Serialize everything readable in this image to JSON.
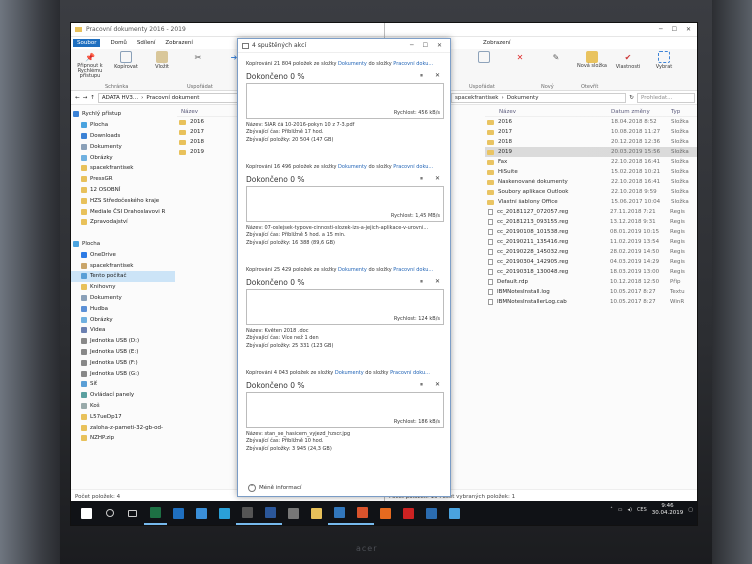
{
  "left_window": {
    "title": "Pracovní dokumenty 2016 - 2019",
    "tabs": [
      "Soubor",
      "Domů",
      "Sdílení",
      "Zobrazení"
    ],
    "ribbon": {
      "pin_label": "Připnout k Rychlému přístupu",
      "copy_label": "Kopírovat",
      "paste_label": "Vložit",
      "group_clipboard": "Schránka",
      "group_organize": "Uspořádat"
    },
    "address": [
      "ADATA HV3...",
      "Pracovní dokument"
    ],
    "nav": [
      {
        "label": "Rychlý přístup",
        "icon": "star-icon",
        "color": "#3b82d6"
      },
      {
        "label": "Plocha",
        "icon": "desktop-icon",
        "color": "#4aa3df"
      },
      {
        "label": "Downloads",
        "icon": "download-icon",
        "color": "#3b82d6"
      },
      {
        "label": "Dokumenty",
        "icon": "documents-icon",
        "color": "#8aa0b8"
      },
      {
        "label": "Obrázky",
        "icon": "pictures-icon",
        "color": "#6fb0e0"
      },
      {
        "label": "spacekfrantisek",
        "icon": "folder-icon",
        "color": "#e8c15a"
      },
      {
        "label": "PressGR",
        "icon": "folder-icon",
        "color": "#e8c15a"
      },
      {
        "label": "12 OSOBNÍ",
        "icon": "folder-icon",
        "color": "#e8c15a"
      },
      {
        "label": "HZS Středočeského kraje",
        "icon": "folder-icon",
        "color": "#e8c15a"
      },
      {
        "label": "Mediale ČSI Drahoslavovi R",
        "icon": "folder-icon",
        "color": "#e8c15a"
      },
      {
        "label": "Zpravodajství",
        "icon": "folder-icon",
        "color": "#e8c15a"
      },
      {
        "label": "",
        "icon": "",
        "color": "#fbfbfb"
      },
      {
        "label": "Plocha",
        "icon": "desktop-icon",
        "color": "#4aa3df"
      },
      {
        "label": "OneDrive",
        "icon": "cloud-icon",
        "color": "#2c7be5"
      },
      {
        "label": "spacekfrantisek",
        "icon": "user-icon",
        "color": "#c9a56a"
      },
      {
        "label": "Tento počítač",
        "icon": "computer-icon",
        "color": "#5a9fd6"
      },
      {
        "label": "Knihovny",
        "icon": "library-icon",
        "color": "#e8c15a"
      },
      {
        "label": "Dokumenty",
        "icon": "documents-icon",
        "color": "#8aa0b8"
      },
      {
        "label": "Hudba",
        "icon": "music-icon",
        "color": "#5a8fd6"
      },
      {
        "label": "Obrázky",
        "icon": "pictures-icon",
        "color": "#6fb0e0"
      },
      {
        "label": "Videa",
        "icon": "video-icon",
        "color": "#6a7fb0"
      },
      {
        "label": "Jednotka USB (D:)",
        "icon": "usb-drive-icon",
        "color": "#888888"
      },
      {
        "label": "Jednotka USB (E:)",
        "icon": "usb-drive-icon",
        "color": "#888888"
      },
      {
        "label": "Jednotka USB (F:)",
        "icon": "usb-drive-icon",
        "color": "#888888"
      },
      {
        "label": "Jednotka USB (G:)",
        "icon": "usb-drive-icon",
        "color": "#888888"
      },
      {
        "label": "Síť",
        "icon": "network-icon",
        "color": "#5a9fd6"
      },
      {
        "label": "Ovládací panely",
        "icon": "control-panel-icon",
        "color": "#5aa0a0"
      },
      {
        "label": "Koš",
        "icon": "recycle-bin-icon",
        "color": "#9aa"
      },
      {
        "label": "L57ueDp17",
        "icon": "folder-icon",
        "color": "#e8c15a"
      },
      {
        "label": "zaloha-z-pameti-32-gb-od-",
        "icon": "folder-icon",
        "color": "#e8c15a"
      },
      {
        "label": "NZHP.zip",
        "icon": "zip-icon",
        "color": "#e8c15a"
      }
    ],
    "list_header": "Název",
    "folders": [
      "2016",
      "2017",
      "2018",
      "2019"
    ],
    "status": "Počet položek: 4"
  },
  "right_window": {
    "tabs": [
      "Zobrazení"
    ],
    "ribbon": {
      "new_folder_label": "Nová složka",
      "properties_label": "Vlastnosti",
      "select_label": "Vybrat",
      "group_new": "Nový",
      "group_open": "Otevřít",
      "group_organize": "Uspořádat"
    },
    "address": [
      "spacekfrantisek",
      "Dokumenty"
    ],
    "search_placeholder": "Prohledat...",
    "columns": [
      "Název",
      "Datum změny",
      "Typ"
    ],
    "files": [
      {
        "name": "2016",
        "date": "18.04.2018 8:52",
        "type": "Složka",
        "kind": "folder"
      },
      {
        "name": "2017",
        "date": "10.08.2018 11:27",
        "type": "Složka",
        "kind": "folder"
      },
      {
        "name": "2018",
        "date": "20.12.2018 12:36",
        "type": "Složka",
        "kind": "folder"
      },
      {
        "name": "2019",
        "date": "20.03.2019 15:56",
        "type": "Složka",
        "kind": "folder",
        "selected": true
      },
      {
        "name": "Fax",
        "date": "22.10.2018 16:41",
        "type": "Složka",
        "kind": "folder"
      },
      {
        "name": "HiSuite",
        "date": "15.02.2018 10:21",
        "type": "Složka",
        "kind": "folder"
      },
      {
        "name": "Naskenované dokumenty",
        "date": "22.10.2018 16:41",
        "type": "Složka",
        "kind": "folder"
      },
      {
        "name": "Soubory aplikace Outlook",
        "date": "22.10.2018 9:59",
        "type": "Složka",
        "kind": "folder"
      },
      {
        "name": "Vlastní šablony Office",
        "date": "15.06.2017 10:04",
        "type": "Složka",
        "kind": "folder"
      },
      {
        "name": "cc_20181127_072057.reg",
        "date": "27.11.2018 7:21",
        "type": "Regis",
        "kind": "file"
      },
      {
        "name": "cc_20181213_093155.reg",
        "date": "13.12.2018 9:31",
        "type": "Regis",
        "kind": "file"
      },
      {
        "name": "cc_20190108_101538.reg",
        "date": "08.01.2019 10:15",
        "type": "Regis",
        "kind": "file"
      },
      {
        "name": "cc_20190211_135416.reg",
        "date": "11.02.2019 13:54",
        "type": "Regis",
        "kind": "file"
      },
      {
        "name": "cc_20190228_145032.reg",
        "date": "28.02.2019 14:50",
        "type": "Regis",
        "kind": "file"
      },
      {
        "name": "cc_20190304_142905.reg",
        "date": "04.03.2019 14:29",
        "type": "Regis",
        "kind": "file"
      },
      {
        "name": "cc_20190318_130048.reg",
        "date": "18.03.2019 13:00",
        "type": "Regis",
        "kind": "file"
      },
      {
        "name": "Default.rdp",
        "date": "10.12.2018 12:50",
        "type": "Přip",
        "kind": "file"
      },
      {
        "name": "IBMNotesInstall.log",
        "date": "10.05.2017 8:27",
        "type": "Textu",
        "kind": "file"
      },
      {
        "name": "IBMNotesInstallerLog.cab",
        "date": "10.05.2017 8:27",
        "type": "WinR",
        "kind": "file"
      }
    ],
    "status": "Počet položek: 19    Počet vybraných položek: 1"
  },
  "dialog": {
    "title": "4 spuštěných akcí",
    "operations": [
      {
        "copy_prefix": "Kopírování 21 804 položek ze složky",
        "src": "Dokumenty",
        "mid": "do složky",
        "dst": "Pracovní doku...",
        "progress_label": "Dokončeno 0 %",
        "progress": 0,
        "speed": "Rychlost: 456 kB/s",
        "name": "Název: SIAR čá 10-2016-pokyn 10 z 7-3.pdf",
        "time_left": "Zbývající čas: Přibližně 17 hod.",
        "items_left": "Zbývající položky: 20 504 (147 GB)"
      },
      {
        "copy_prefix": "Kopírování 16 496 položek ze složky",
        "src": "Dokumenty",
        "mid": "do složky",
        "dst": "Pracovní doku...",
        "progress_label": "Dokončeno 0 %",
        "progress": 0,
        "speed": "Rychlost: 1,45 MB/s",
        "name": "Název: 07-oslejsek-typove-cinnosti-slozek-izs-a-jejich-aplikace-v-urovni...",
        "time_left": "Zbývající čas: Přibližně 5 hod. a 15 min.",
        "items_left": "Zbývající položky: 16 388 (89,6 GB)"
      },
      {
        "copy_prefix": "Kopírování 25 429 položek ze složky",
        "src": "Dokumenty",
        "mid": "do složky",
        "dst": "Pracovní doku...",
        "progress_label": "Dokončeno 0 %",
        "progress": 0,
        "speed": "Rychlost: 124 kB/s",
        "name": "Název: Květen 2018 .doc",
        "time_left": "Zbývající čas: Více než 1 den",
        "items_left": "Zbývající položky: 25 331 (123 GB)"
      },
      {
        "copy_prefix": "Kopírování 4 043 položek ze složky",
        "src": "Dokumenty",
        "mid": "do složky",
        "dst": "Pracovní doku...",
        "progress_label": "Dokončeno 0 %",
        "progress": 0,
        "speed": "Rychlost: 186 kB/s",
        "name": "Název: stan_se_hasicem_vyjezd_hzscr.jpg",
        "time_left": "Zbývající čas: Přibližně 10 hod.",
        "items_left": "Zbývající položky: 3 945 (24,3 GB)"
      }
    ],
    "less_info": "Méně informací"
  },
  "taskbar": {
    "icons": [
      {
        "name": "start-icon",
        "color": "#ffffff"
      },
      {
        "name": "search-icon",
        "color": "#cccccc"
      },
      {
        "name": "task-view-icon",
        "color": "#cccccc"
      },
      {
        "name": "excel-icon",
        "color": "#1d7044"
      },
      {
        "name": "app-icon",
        "color": "#1f6fbf"
      },
      {
        "name": "app-icon",
        "color": "#3a8fd9"
      },
      {
        "name": "globe-icon",
        "color": "#2aa0d8"
      },
      {
        "name": "app-icon",
        "color": "#555555"
      },
      {
        "name": "word-icon",
        "color": "#2b579a"
      },
      {
        "name": "app-icon",
        "color": "#777777"
      },
      {
        "name": "explorer-icon",
        "color": "#e8c15a"
      },
      {
        "name": "edge-icon",
        "color": "#3277bc"
      },
      {
        "name": "xmind-icon",
        "color": "#d9532c"
      },
      {
        "name": "firefox-icon",
        "color": "#e66a1f"
      },
      {
        "name": "app-icon",
        "color": "#c22"
      },
      {
        "name": "outlook-icon",
        "color": "#2b6cb0"
      },
      {
        "name": "app-icon",
        "color": "#4aa3df"
      }
    ],
    "lang": "CES",
    "time": "9:46",
    "date": "30.04.2019"
  },
  "monitor_brand": "acer"
}
